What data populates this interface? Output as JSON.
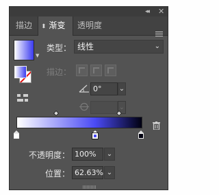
{
  "window": {
    "collapse_glyph": "◂◂",
    "close_glyph": "✕"
  },
  "tabs": [
    {
      "label": "描边",
      "active": false
    },
    {
      "label": "渐变",
      "active": true,
      "prefix_glyph": "⬍"
    },
    {
      "label": "透明度",
      "active": false
    }
  ],
  "gradient": {
    "type_label": "类型：",
    "type_value": "线性",
    "stroke_label": "描边：",
    "angle_value": "0°",
    "aspect_value": "",
    "opacity_label": "不透明度：",
    "opacity_value": "100%",
    "location_label": "位置：",
    "location_value": "62.63%",
    "stops": [
      {
        "location": 0,
        "color": "#ffffff"
      },
      {
        "location": 62.63,
        "color": "#4a4af5",
        "selected": true
      },
      {
        "location": 100,
        "color": "#000010"
      }
    ],
    "midpoints": [
      31,
      81
    ]
  },
  "colors": {
    "panel_bg": "#535353",
    "accent": "#4a4af5",
    "stroke_none": "#e01010"
  },
  "icons": [
    "collapse-icon",
    "close-icon",
    "panel-menu-icon",
    "angle-icon",
    "aspect-ratio-icon",
    "reverse-gradient-icon",
    "delete-stop-icon"
  ]
}
